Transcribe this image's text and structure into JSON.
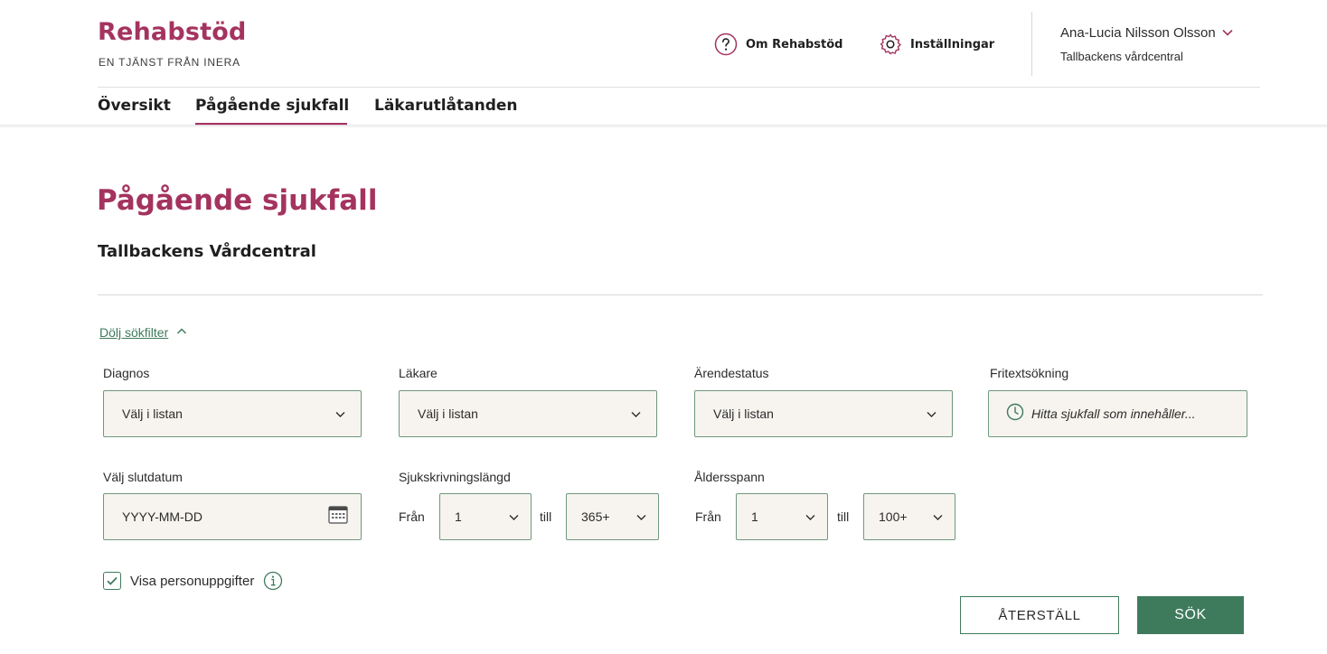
{
  "header": {
    "logo_title": "Rehabstöd",
    "logo_subtitle": "EN TJÄNST FRÅN INERA",
    "about_label": "Om Rehabstöd",
    "settings_label": "Inställningar",
    "user_name": "Ana-Lucia Nilsson Olsson",
    "user_unit": "Tallbackens vårdcentral"
  },
  "nav": {
    "items": [
      {
        "label": "Översikt",
        "active": false
      },
      {
        "label": "Pågående sjukfall",
        "active": true
      },
      {
        "label": "Läkarutlåtanden",
        "active": false
      }
    ]
  },
  "page": {
    "title": "Pågående sjukfall",
    "subtitle": "Tallbackens Vårdcentral"
  },
  "filters": {
    "toggle_label": "Dölj sökfilter",
    "diagnos": {
      "label": "Diagnos",
      "value": "Välj i listan"
    },
    "lakare": {
      "label": "Läkare",
      "value": "Välj i listan"
    },
    "arendestatus": {
      "label": "Ärendestatus",
      "value": "Välj i listan"
    },
    "fritext": {
      "label": "Fritextsökning",
      "placeholder": "Hitta sjukfall som innehåller..."
    },
    "slutdatum": {
      "label": "Välj slutdatum",
      "placeholder": "YYYY-MM-DD"
    },
    "sjukskrivningslangd": {
      "label": "Sjukskrivningslängd",
      "from_word": "Från",
      "to_word": "till",
      "from_value": "1",
      "to_value": "365+"
    },
    "aldersspann": {
      "label": "Åldersspann",
      "from_word": "Från",
      "to_word": "till",
      "from_value": "1",
      "to_value": "100+"
    },
    "show_personal": {
      "label": "Visa personuppgifter",
      "checked": true
    }
  },
  "actions": {
    "reset_label": "ÅTERSTÄLL",
    "search_label": "SÖK"
  },
  "colors": {
    "brand": "#a4335f",
    "accent_green": "#3e7b5c",
    "field_bg": "#f7f4ef"
  }
}
